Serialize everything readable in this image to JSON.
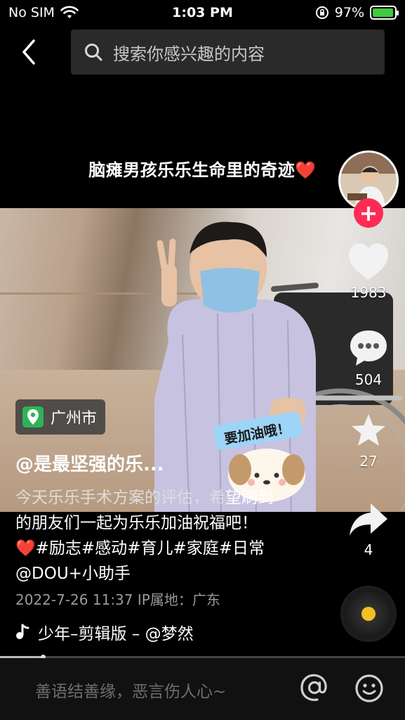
{
  "status_bar": {
    "carrier": "No SIM",
    "time": "1:03 PM",
    "battery": "97%",
    "battery_level": 0.97
  },
  "search": {
    "placeholder": "搜索你感兴趣的内容"
  },
  "video": {
    "title_overlay": "脑瘫男孩乐乐生命里的奇迹❤️",
    "sticker_text": "要加油哦！"
  },
  "actions": {
    "likes": "1983",
    "comments": "504",
    "favorites": "27",
    "shares": "4"
  },
  "location": {
    "label": "广州市"
  },
  "post": {
    "author": "@是最坚强的乐...",
    "description_first": "今天乐乐手术方案的评估，希",
    "description_rest": "望刷到的朋友们一起为乐乐加油祝福吧！❤️#励志#感动#育儿#家庭#日常 @DOU+小助手",
    "meta": "2022-7-26 11:37  IP属地：广东"
  },
  "music": {
    "label": "少年–剪辑版 – @梦然"
  },
  "comment": {
    "placeholder": "善语结善缘，恶言伤人心~"
  },
  "colors": {
    "accent": "#fe2c55",
    "location_pin": "#2cb457",
    "disc_core": "#f3c023"
  }
}
